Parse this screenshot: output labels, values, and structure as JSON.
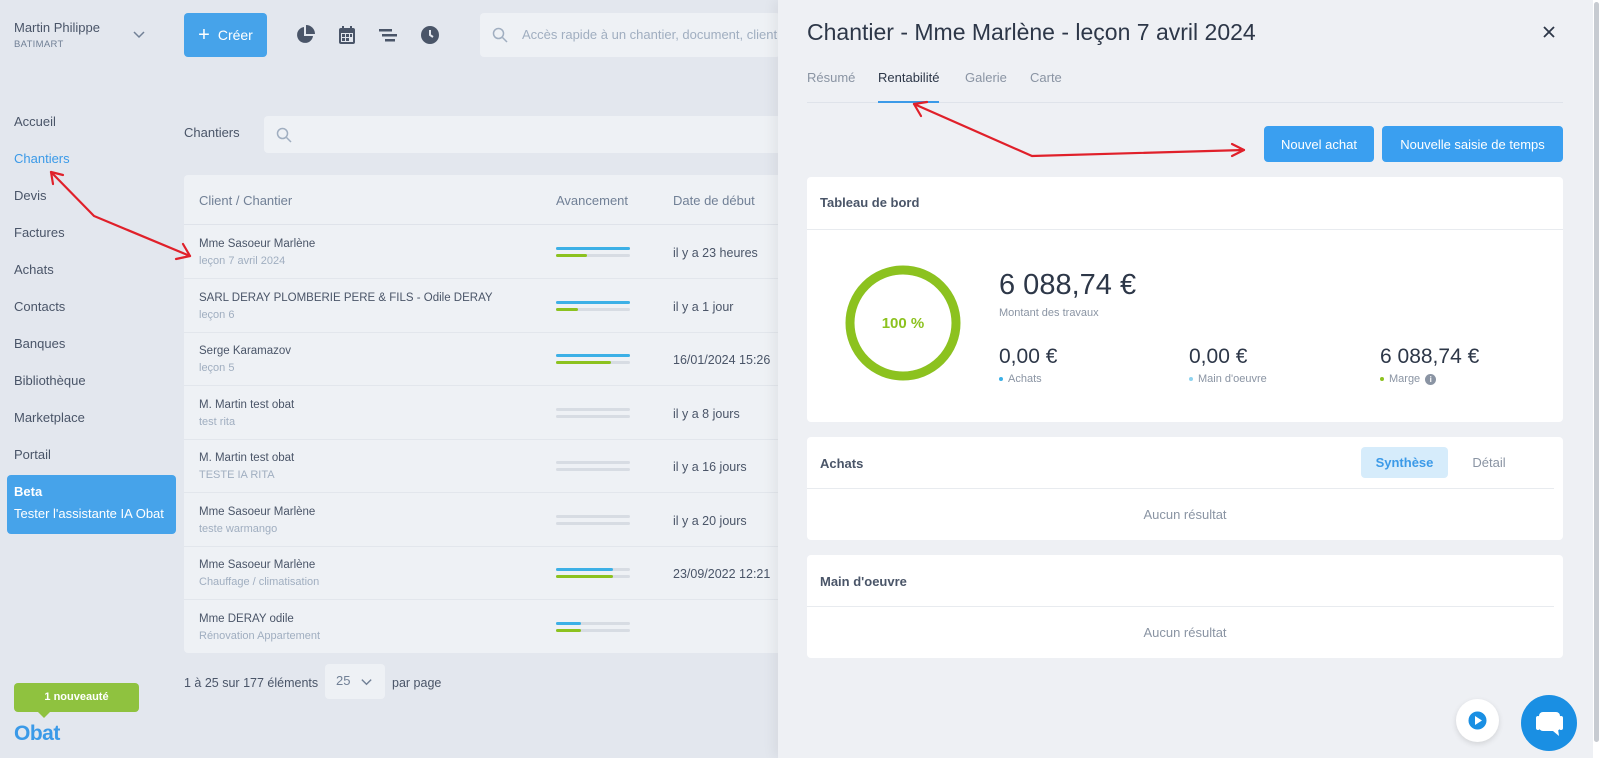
{
  "user": {
    "name": "Martin Philippe",
    "company": "BATIMART"
  },
  "nav": [
    "Accueil",
    "Chantiers",
    "Devis",
    "Factures",
    "Achats",
    "Contacts",
    "Banques",
    "Bibliothèque",
    "Marketplace",
    "Portail"
  ],
  "beta": {
    "title": "Beta",
    "text": "Tester l'assistante IA Obat"
  },
  "news": "1 nouveauté",
  "logo": "Obat",
  "toolbar": {
    "create_label": "Créer",
    "search_placeholder": "Accès rapide à un chantier, document, client"
  },
  "list": {
    "section_label": "Chantiers",
    "columns": [
      "Client / Chantier",
      "Avancement",
      "Date de début"
    ],
    "rows": [
      {
        "client": "Mme Sasoeur Marlène",
        "job": "leçon 7 avril 2024",
        "progress_blue": 1.0,
        "progress_green": 0.42,
        "date": "il y a 23 heures"
      },
      {
        "client": "SARL DERAY PLOMBERIE PERE & FILS - Odile DERAY",
        "job": "leçon 6",
        "progress_blue": 1.0,
        "progress_green": 0.3,
        "date": "il y a 1 jour"
      },
      {
        "client": "Serge Karamazov",
        "job": "leçon 5",
        "progress_blue": 1.0,
        "progress_green": 0.74,
        "date": "16/01/2024 15:26"
      },
      {
        "client": "M. Martin test obat",
        "job": "test rita",
        "progress_blue": 0.0,
        "progress_green": 0.0,
        "date": "il y a 8 jours"
      },
      {
        "client": "M. Martin test obat",
        "job": "TESTE IA RITA",
        "progress_blue": 0.0,
        "progress_green": 0.0,
        "date": "il y a 16 jours"
      },
      {
        "client": "Mme Sasoeur Marlène",
        "job": "teste warmango",
        "progress_blue": 0.0,
        "progress_green": 0.0,
        "date": "il y a 20 jours"
      },
      {
        "client": "Mme Sasoeur Marlène",
        "job": "Chauffage / climatisation",
        "progress_blue": 0.77,
        "progress_green": 0.77,
        "date": "23/09/2022 12:21"
      },
      {
        "client": "Mme DERAY odile",
        "job": "Rénovation Appartement",
        "progress_blue": 0.34,
        "progress_green": 0.34,
        "date": ""
      }
    ],
    "pager_text": "1 à 25 sur 177 éléments",
    "per_page_value": "25",
    "per_page_label": "par page"
  },
  "panel": {
    "title": "Chantier - Mme Marlène - leçon 7 avril 2024",
    "tabs": [
      "Résumé",
      "Rentabilité",
      "Galerie",
      "Carte"
    ],
    "active_tab": "Rentabilité",
    "buttons": {
      "new_purchase": "Nouvel achat",
      "new_time": "Nouvelle saisie de temps"
    },
    "dashboard": {
      "title": "Tableau de bord",
      "percent": 100,
      "percent_label": "100 %",
      "total_amount": "6 088,74 €",
      "total_label": "Montant des travaux",
      "kpis": [
        {
          "value": "0,00 €",
          "label": "Achats",
          "color": "#3cb0e6"
        },
        {
          "value": "0,00 €",
          "label": "Main d'oeuvre",
          "color": "#8fd3ef"
        },
        {
          "value": "6 088,74 €",
          "label": "Marge",
          "color": "#8cc21f"
        }
      ]
    },
    "purchases": {
      "title": "Achats",
      "seg_on": "Synthèse",
      "seg_off": "Détail",
      "empty": "Aucun résultat"
    },
    "labour": {
      "title": "Main d'oeuvre",
      "empty": "Aucun résultat"
    }
  },
  "colors": {
    "accent": "#3b9ae8",
    "green": "#8cc21f",
    "annotation": "#e0202a"
  }
}
